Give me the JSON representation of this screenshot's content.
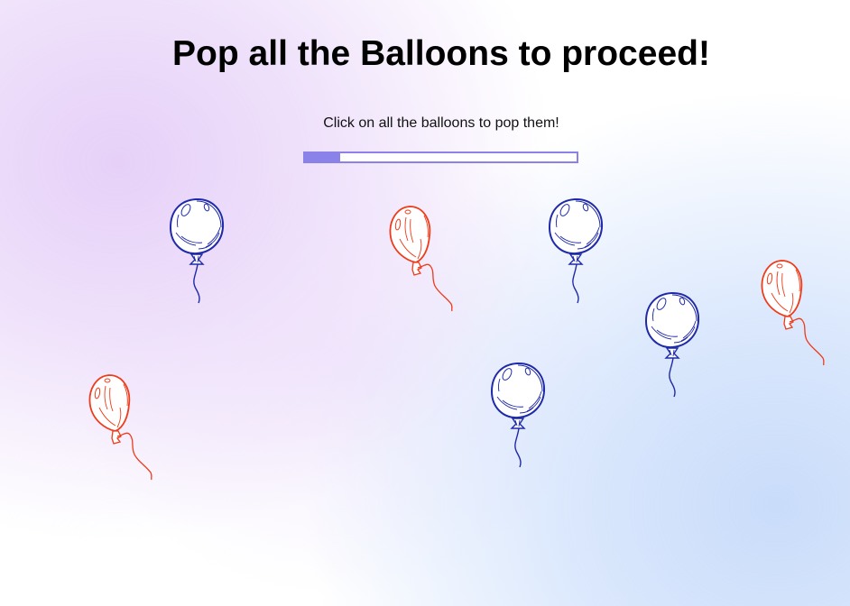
{
  "game": {
    "title": "Pop all the Balloons to proceed!",
    "instruction": "Click on all the balloons to pop them!",
    "progress_fraction": 0.13,
    "colors": {
      "blue_balloon": "#1f2aa8",
      "red_balloon": "#ee3b1a",
      "progress": "#8a82e8"
    }
  },
  "balloons": [
    {
      "color": "blue"
    },
    {
      "color": "red"
    },
    {
      "color": "blue"
    },
    {
      "color": "blue"
    },
    {
      "color": "red"
    },
    {
      "color": "red"
    },
    {
      "color": "blue"
    }
  ]
}
